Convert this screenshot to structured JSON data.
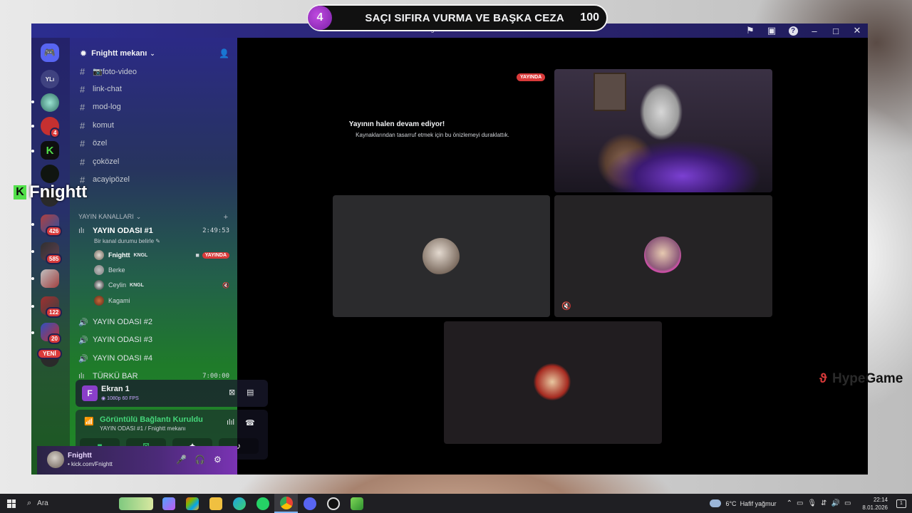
{
  "overlay": {
    "challenge_number": "4",
    "challenge_title": "SAÇI SIFIRA VURMA VE BAŞKA CEZA",
    "challenge_count": "100",
    "streamer_logo_text": "Fnightt",
    "sponsor_text_a": "Hype",
    "sponsor_text_b": "Game"
  },
  "window": {
    "title": "Fnightt mekanı"
  },
  "rail": {
    "home_label": "YLı",
    "badges": [
      "4",
      "426",
      "585",
      "122",
      "20"
    ],
    "new_label": "YENİ"
  },
  "sidebar": {
    "server_name": "Fnightt mekanı",
    "channels": [
      "📷foto-video",
      "link-chat",
      "mod-log",
      "komut",
      "özel",
      "çoközel",
      "acayipözel"
    ],
    "category": "YAYIN KANALLARI",
    "voice_channels": [
      {
        "name": "YAYIN ODASI #1",
        "time": "2:49:53"
      },
      {
        "name": "YAYIN ODASI #2",
        "time": ""
      },
      {
        "name": "YAYIN ODASI #3",
        "time": ""
      },
      {
        "name": "YAYIN ODASI #4",
        "time": ""
      },
      {
        "name": "TÜRKÜ BAR",
        "time": "7:00:00"
      }
    ],
    "voice_status": "Bir kanal durumu belirle",
    "users": [
      {
        "name": "Fnightt",
        "tag": "KNGL",
        "live": "YAYINDA"
      },
      {
        "name": "Berke",
        "tag": ""
      },
      {
        "name": "Ceylin",
        "tag": "KNGL"
      },
      {
        "name": "Kagami",
        "tag": ""
      }
    ]
  },
  "screen_share": {
    "name": "Ekran 1",
    "quality": "1080p 60 FPS"
  },
  "voice_panel": {
    "title": "Görüntülü Bağlantı Kuruldu",
    "subtitle": "YAYIN ODASI #1 / Fnightt mekanı"
  },
  "user_bar": {
    "username": "Fnightt",
    "status": "• kick.com/Fnightt"
  },
  "stage": {
    "paused_title": "Yayının halen devam ediyor!",
    "paused_subtitle": "Kaynaklarından tasarruf etmek için bu önizlemeyi duraklattık.",
    "live_label": "YAYINDA"
  },
  "taskbar": {
    "search_label": "Ara",
    "weather_temp": "6°C",
    "weather_desc": "Hafif yağmur",
    "time": "22:14",
    "date": "8.01.2026",
    "notif_count": "1"
  },
  "colors": {
    "accent_live": "#d93a3a",
    "connected_green": "#45d67a",
    "sidebar_top": "#2b2a86",
    "sidebar_bottom": "#218a27"
  }
}
